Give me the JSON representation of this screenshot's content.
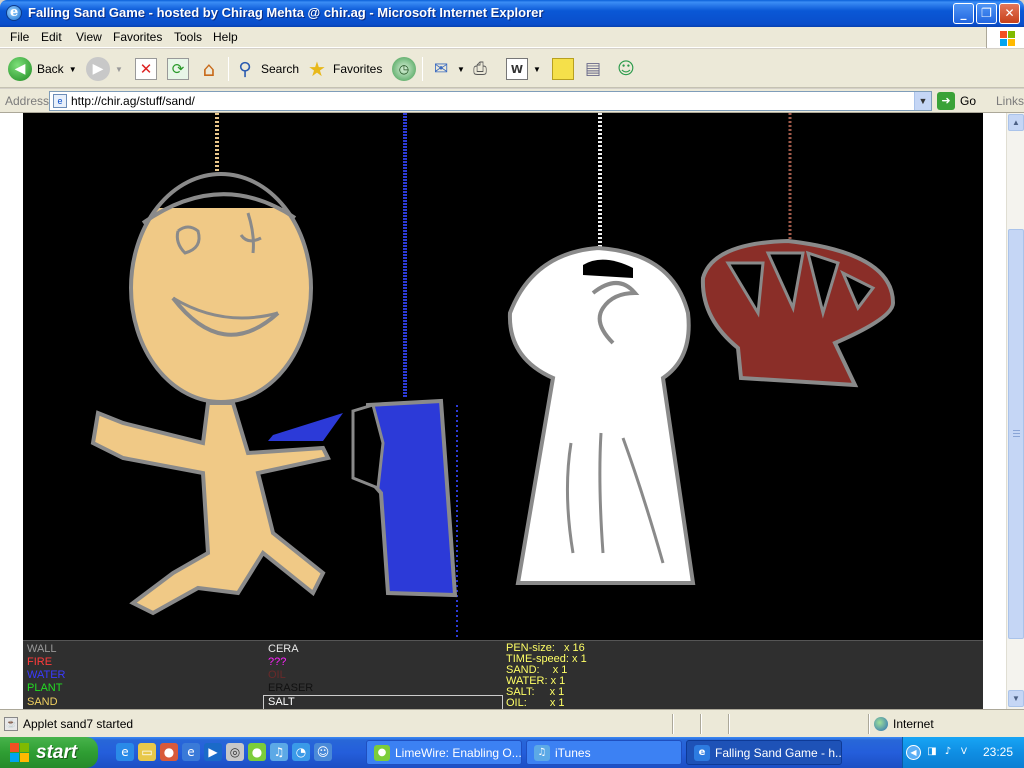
{
  "window": {
    "title": "Falling Sand Game - hosted by Chirag Mehta @ chir.ag - Microsoft Internet Explorer",
    "min": "_",
    "max": "❐",
    "close": "✕"
  },
  "menu": [
    "File",
    "Edit",
    "View",
    "Favorites",
    "Tools",
    "Help"
  ],
  "toolbar": {
    "back": "Back",
    "search": "Search",
    "favorites": "Favorites"
  },
  "address": {
    "label": "Address",
    "url": "http://chir.ag/stuff/sand/",
    "go": "Go",
    "links": "Links"
  },
  "elements_left": [
    {
      "label": "WALL",
      "color": "#999999"
    },
    {
      "label": "FIRE",
      "color": "#ff3b3b"
    },
    {
      "label": "WATER",
      "color": "#3a3aff"
    },
    {
      "label": "PLANT",
      "color": "#22dd22"
    },
    {
      "label": "SAND",
      "color": "#f0d060"
    }
  ],
  "elements_right": [
    {
      "label": "CERA",
      "color": "#e8e8e8"
    },
    {
      "label": "???",
      "color": "#ff22ff"
    },
    {
      "label": "OIL",
      "color": "#6a2a2a"
    },
    {
      "label": "ERASER",
      "color": "#111111"
    },
    {
      "label": "SALT",
      "color": "#ffffff",
      "selected": true
    }
  ],
  "stats": [
    {
      "label": "PEN-size:",
      "value": "x 16"
    },
    {
      "label": "TIME-speed:",
      "value": "x 1"
    },
    {
      "label": "SAND:",
      "value": "x 1"
    },
    {
      "label": "WATER:",
      "value": "x 1"
    },
    {
      "label": "SALT:",
      "value": "x 1"
    },
    {
      "label": "OIL:",
      "value": "x 1"
    }
  ],
  "status": {
    "text": "Applet sand7 started",
    "zone": "Internet"
  },
  "taskbar": {
    "start": "start",
    "tasks": [
      {
        "label": "LimeWire: Enabling O...",
        "icon_color": "#7ccd3a"
      },
      {
        "label": "iTunes",
        "icon_color": "#5ca9e6"
      },
      {
        "label": "Falling Sand Game - h...",
        "icon_color": "#2d7be0",
        "active": true
      }
    ],
    "clock": "23:25"
  }
}
